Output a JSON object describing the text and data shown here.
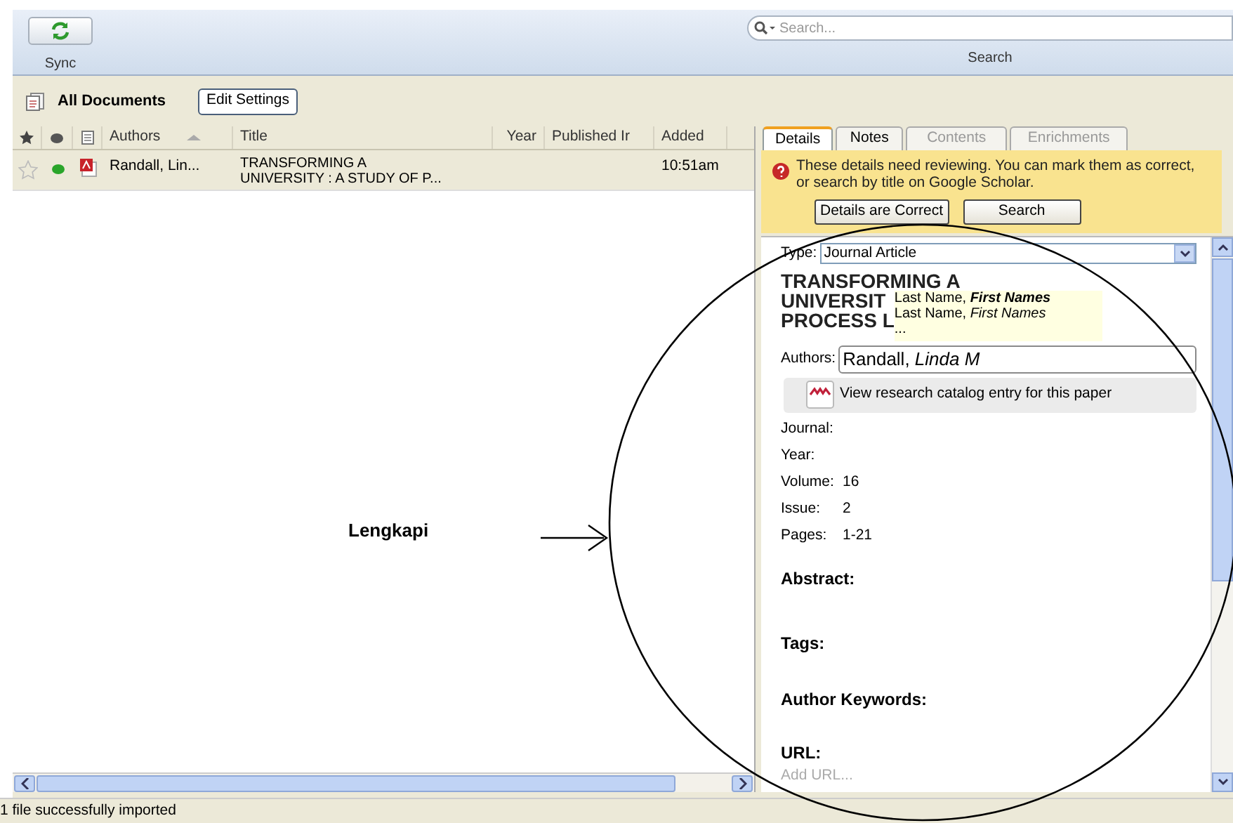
{
  "toolbar": {
    "sync_label": "Sync",
    "search": {
      "placeholder": "Search...",
      "label": "Search"
    }
  },
  "library": {
    "title": "All Documents",
    "edit_button": "Edit Settings"
  },
  "table": {
    "columns": [
      {
        "kind": "star"
      },
      {
        "kind": "dot"
      },
      {
        "kind": "file"
      },
      {
        "kind": "text",
        "label": "Authors",
        "sorted": true
      },
      {
        "kind": "text",
        "label": "Title",
        "sorted": false
      },
      {
        "kind": "text",
        "label": "Year",
        "sorted": false
      },
      {
        "kind": "text",
        "label": "Published Ir",
        "sorted": false
      },
      {
        "kind": "text",
        "label": "Added",
        "sorted": false
      }
    ],
    "rows": [
      {
        "starred": false,
        "unread": true,
        "authors": "Randall, Lin...",
        "title": "TRANSFORMING A\nUNIVERSITY : A STUDY OF P...",
        "added": "10:51am"
      }
    ]
  },
  "details": {
    "tabs": [
      {
        "label": "Details",
        "selected": true,
        "disabled": false
      },
      {
        "label": "Notes",
        "selected": false,
        "disabled": false
      },
      {
        "label": "Contents",
        "selected": false,
        "disabled": true
      },
      {
        "label": "Enrichments",
        "selected": false,
        "disabled": true
      }
    ],
    "review": {
      "message": "These details need reviewing. You can mark them as correct, or search by title on Google Scholar.",
      "buttons": [
        "Details are Correct",
        "Search"
      ]
    },
    "type_label": "Type:",
    "type_value": "Journal Article",
    "title_lines": [
      "TRANSFORMING A",
      "UNIVERSIT",
      "PROCESS L"
    ],
    "suggestions": [
      "Last Name, **First Names**",
      "Last Name, *First Names*",
      "..."
    ],
    "authors_label": "Authors:",
    "authors_value": "Randall, *Linda M*",
    "catalog_button": "View research catalog entry for this paper",
    "fields": [
      {
        "label": "Journal:"
      },
      {
        "label": "Year:"
      },
      {
        "label": "Volume:",
        "value": "16"
      },
      {
        "label": "Issue:",
        "value": "2"
      },
      {
        "label": "Pages:",
        "value": "1-21"
      }
    ],
    "sections": [
      "Abstract:",
      "Tags:",
      "Author Keywords:",
      "URL:"
    ],
    "url_placeholder": "Add URL..."
  },
  "annotation": {
    "label": "Lengkapi"
  },
  "status_bar": "1 file successfully imported"
}
